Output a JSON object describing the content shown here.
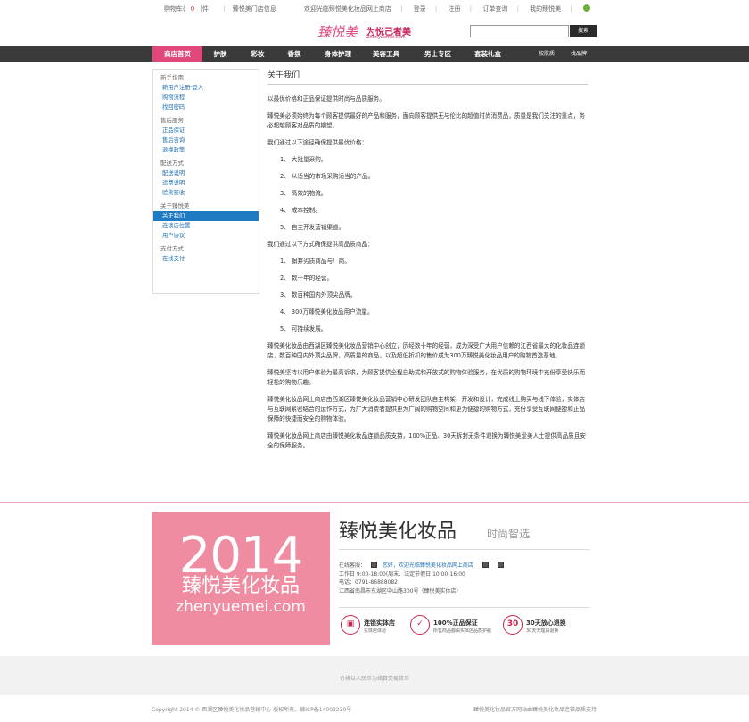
{
  "topbar": {
    "cart_prefix": "购物车(",
    "cart_count": "0",
    "cart_suffix": ")件",
    "store_info": "臻悦美门店信息",
    "welcome": "欢迎光临臻悦美化妆品网上商店",
    "login": "登录",
    "register": "注册",
    "order_query": "订单查询",
    "my_account": "我的臻悦美"
  },
  "header": {
    "logo": "臻悦美",
    "slogan": "为悦己者美",
    "slogan_url": "Zhenyuemei.com",
    "search_placeholder": "",
    "search_button": "搜索"
  },
  "nav": {
    "items": [
      "商店首页",
      "护肤",
      "彩妆",
      "香氛",
      "身体护理",
      "美容工具",
      "男士专区",
      "套装礼盒"
    ],
    "brand_search": "按肤质",
    "brand_list": "找品牌"
  },
  "sidebar": {
    "groups": [
      {
        "title": "新手指南",
        "links": [
          "新用户注册·登入",
          "购物流程",
          "找回密码"
        ]
      },
      {
        "title": "售后服务",
        "links": [
          "正品保证",
          "售后咨询",
          "退换政策"
        ]
      },
      {
        "title": "配送方式",
        "links": [
          "配送说明",
          "运费说明",
          "验货签收"
        ]
      },
      {
        "title": "关于臻悦美",
        "links": [
          "关于我们",
          "连锁店位置",
          "用户协议"
        ]
      },
      {
        "title": "支付方式",
        "links": [
          "在线支付"
        ]
      }
    ]
  },
  "content": {
    "title": "关于我们",
    "p1": "以最优价格和正品保证提供时尚与品质服务。",
    "p2": "臻悦美必须始终为每个顾客提供最好的产品和服务，面向顾客提供无与伦比的超值时尚消费品，质量是我们关注的重点，务必超越顾客对品质的期望。",
    "p3": "我们通过以下途径确保提供最优价格：",
    "list1": [
      "1、 大批量采购。",
      "2、 从适当的市场采购适当的产品。",
      "3、 高效的物流。",
      "4、 成本控制。",
      "5、 自主开发营销渠道。"
    ],
    "p4": "我们通过以下方式确保提供高品质商品：",
    "list2": [
      "1、 摒弃劣质商品与厂商。",
      "2、 数十年的经营。",
      "3、 数百种国内外顶尖品牌。",
      "4、 300万臻悦美化妆品用户流量。",
      "5、 可持续发展。"
    ],
    "p5": "臻悦美化妆品由西湖区臻悦美化妆品营销中心创立，历经数十年的经营，成为深受广大用户信赖的江西省最大的化妆品连锁店，数百种国内外顶尖品牌，高质量的商品，以及超低折扣的售价成为300万臻悦美化妆品用户的购物首选基地。",
    "p6": "臻悦美坚持以用户体验为最高诉求，为顾客提供全程自助式和开放式的购物体验服务，在优质的购物环境中充份享受快乐而轻松的购物乐趣。",
    "p7": "臻悦美化妆品网上商店由西湖区臻悦美化妆品营销中心研发团队自主构架、开发和设计，完成线上购买与线下体验，实体店与互联网紧密结合的运作方式，为广大消费者提供更为广阔的购物空间和更为便捷的购物方式，充份享受互联网便捷和正品保障的快捷而安全的购物体验。",
    "p8": "臻悦美化妆品网上商店由臻悦美化妆品连锁品质支持，100%正品、30天拆封无条件退换为臻悦美爱美人士提供高品质且安全的保障服务。"
  },
  "footer": {
    "banner_year": "2014",
    "banner_name": "臻悦美化妆品",
    "banner_url": "zhenyuemei.com",
    "brand_title": "臻悦美化妆品",
    "brand_sub": "时尚智选",
    "service_label": "在线客服：",
    "service_name": "您好，欢迎光临臻悦美化妆品网上商店",
    "hours": "工作日 9:00-18:00(周末、法定节假日 10:00-16:00",
    "phone": "电话：0791-86888082",
    "address": "江西省南昌市东湖区中山路300号（臻悦美实体店）",
    "badges": [
      {
        "icon": "store-icon",
        "symbol": "▣",
        "title": "连锁实体店",
        "desc": "实体店体验"
      },
      {
        "icon": "shield-icon",
        "symbol": "✓",
        "title": "100%正品保证",
        "desc": "所售商品都由实体店品质护航"
      },
      {
        "icon": "return-icon",
        "symbol": "30",
        "title": "30天放心退换",
        "desc": "30天无理由退换"
      }
    ],
    "note": "价格以人民币为结算交易货币",
    "copyright": "Copyright 2014 © 西湖区臻悦美化妆品营销中心 版权所有。赣ICP备14003230号",
    "supported": "臻悦美化妆品官方网站由臻悦美化妆品连锁品质支持"
  }
}
